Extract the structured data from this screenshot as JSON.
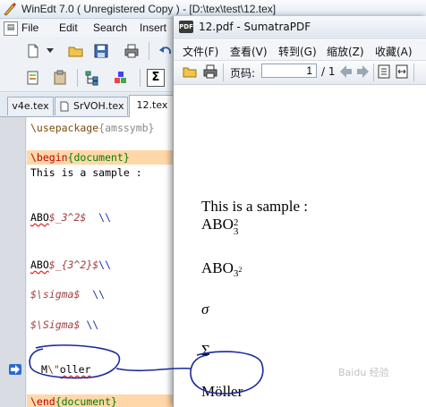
{
  "winedt": {
    "title": "WinEdt 7.0 ( Unregistered  Copy ) - [D:\\tex\\test\\12.tex]",
    "menu": [
      "File",
      "Edit",
      "Search",
      "Insert"
    ],
    "tabs": [
      "v4e.tex",
      "SrVOH.tex",
      "12.tex"
    ],
    "active_tab": "12.tex",
    "lines": {
      "l1_cmd": "\\usepackage",
      "l1_arg": "{amssymb}",
      "l2_cmd": "\\begin",
      "l2_arg": "{document}",
      "l3": "This is a sample :",
      "l4_text": "ABO",
      "l4_math": "$_3^2$",
      "l4_tail": "  \\\\",
      "l5_text": "ABO",
      "l5_math": "$_{3^2}$",
      "l5_tail": "\\\\",
      "l6_math": "$\\sigma$",
      "l6_tail": "  \\\\",
      "l7_math": "$\\Sigma$",
      "l7_tail": " \\\\",
      "l8_pre": "M",
      "l8_cmd": "\\\"",
      "l8_post": "oller",
      "l9_cmd": "\\end",
      "l9_arg": "{document}"
    }
  },
  "sumatra": {
    "title": "12.pdf - SumatraPDF",
    "menu": [
      "文件(F)",
      "查看(V)",
      "转到(G)",
      "缩放(Z)",
      "收藏(A)"
    ],
    "page_label": "页码:",
    "page_value": "1",
    "page_total": "/ 1",
    "doc": {
      "l1": "This is a sample :",
      "l2_base": "ABO",
      "l2_sub": "3",
      "l2_sup": "2",
      "l3_base": "ABO",
      "l3_sub": "3",
      "l3_subsup": "2",
      "l4": "σ",
      "l5": "Σ",
      "l6": "Möller"
    }
  },
  "watermark": "Baidu 经验",
  "colors": {
    "annotation": "#1a2a9c",
    "highlight": "#ffd7a8",
    "keyword": "#7a4a0a"
  }
}
